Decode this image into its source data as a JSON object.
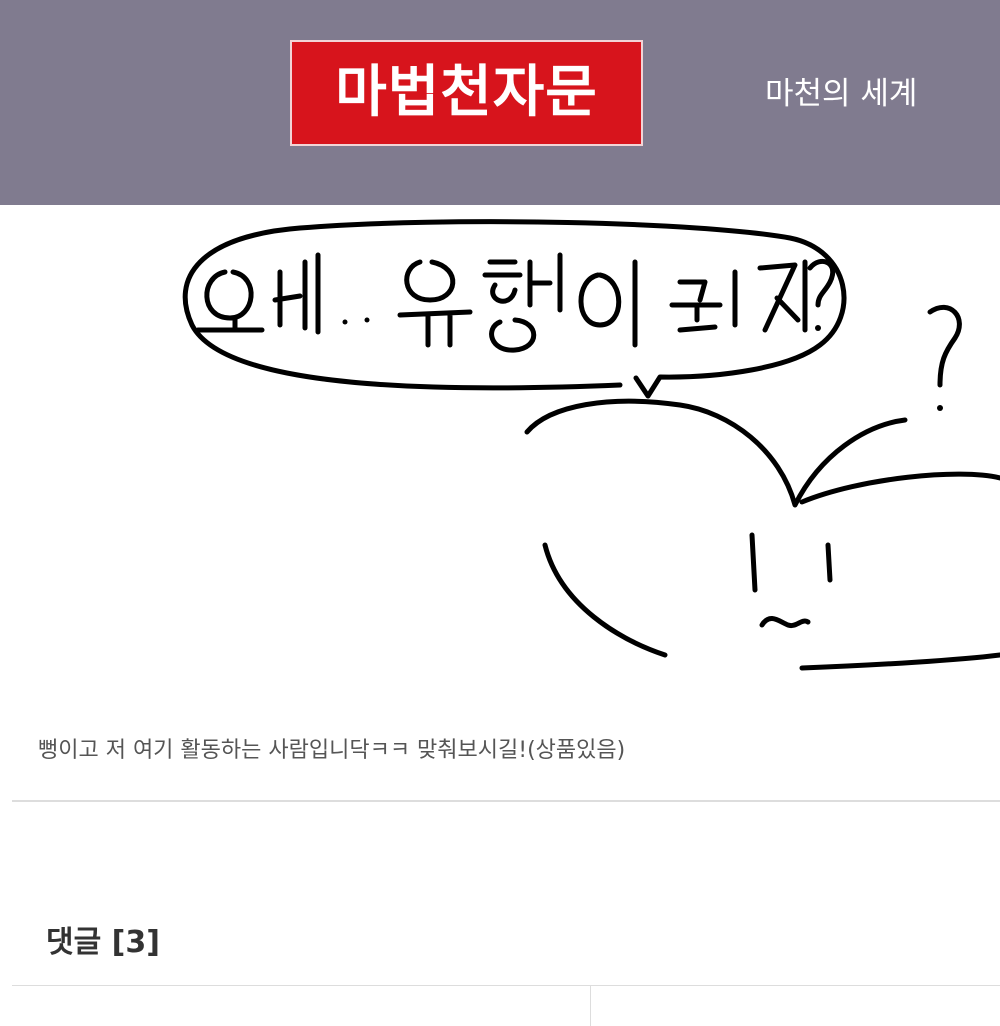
{
  "header": {
    "logo_text": "마법천자문",
    "site_title": "마천의 세계",
    "background": "#807b8f",
    "logo_color": "#d7141c"
  },
  "post": {
    "drawing_text": "왜.. 유행이 됐지?",
    "caption": "뻥이고 저 여기 활동하는 사람입니닥ㅋㅋ 맞춰보시길!(상품있음)"
  },
  "comments": {
    "title": "댓글 [3]"
  }
}
